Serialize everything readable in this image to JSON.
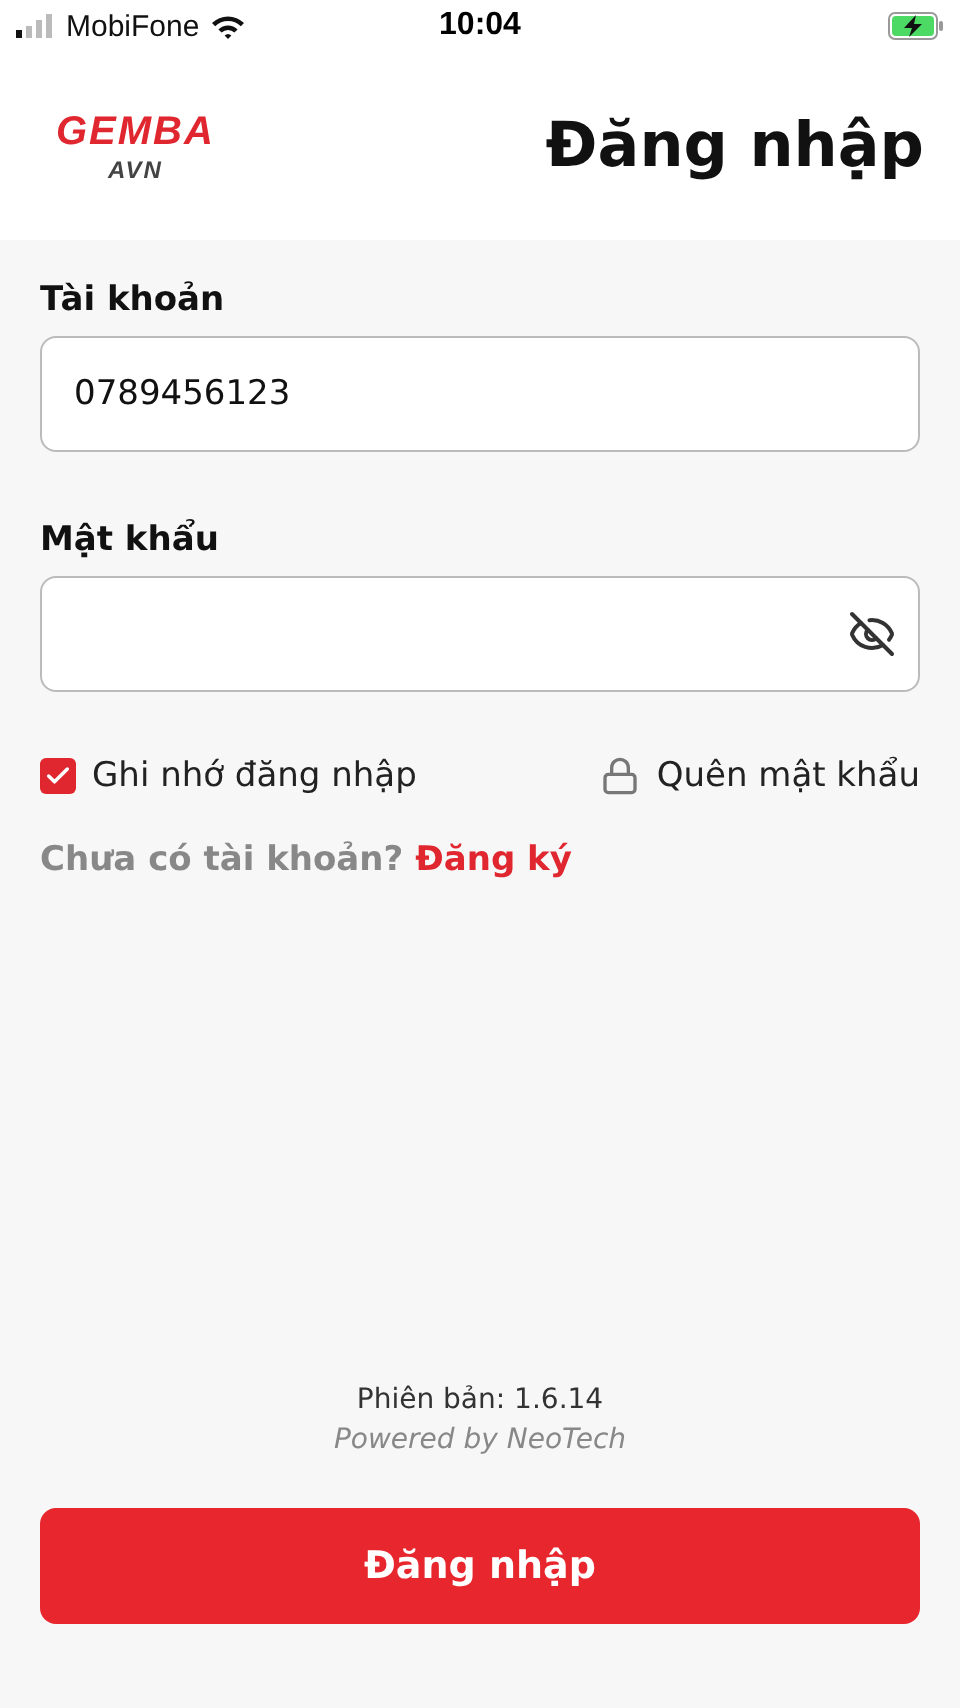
{
  "status_bar": {
    "carrier": "MobiFone",
    "time": "10:04"
  },
  "header": {
    "logo_main": "GEMBA",
    "logo_sub": "AVN",
    "title": "Đăng nhập"
  },
  "form": {
    "account": {
      "label": "Tài khoản",
      "value": "0789456123"
    },
    "password": {
      "label": "Mật khẩu"
    },
    "remember": {
      "label": "Ghi nhớ đăng nhập",
      "checked": true
    },
    "forgot": "Quên mật khẩu",
    "signup_prompt": "Chưa có tài khoản?",
    "signup_link": "Đăng ký"
  },
  "footer": {
    "version": "Phiên bản: 1.6.14",
    "powered": "Powered by NeoTech",
    "button": "Đăng nhập"
  }
}
